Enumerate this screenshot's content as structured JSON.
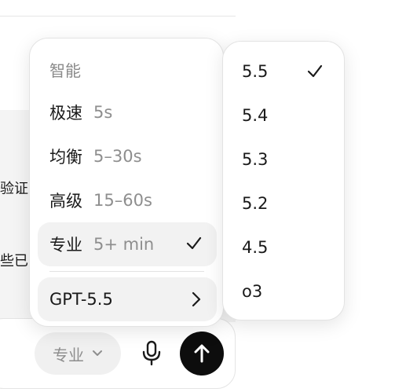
{
  "background": {
    "line1": "验证",
    "line2": "些已"
  },
  "composer": {
    "mode_label": "专业",
    "mode_icon": "chevron-down-icon",
    "mic_icon": "microphone-icon",
    "send_icon": "arrow-up-icon"
  },
  "menu": {
    "heading": "智能",
    "items": [
      {
        "label": "极速",
        "sub": "5s",
        "selected": false
      },
      {
        "label": "均衡",
        "sub": "5–30s",
        "selected": false
      },
      {
        "label": "高级",
        "sub": "15–60s",
        "selected": false
      },
      {
        "label": "专业",
        "sub": "5+ min",
        "selected": true
      }
    ],
    "model_item": {
      "label": "GPT-5.5",
      "icon": "chevron-right-icon"
    }
  },
  "submenu": {
    "items": [
      {
        "label": "5.5",
        "selected": true
      },
      {
        "label": "5.4",
        "selected": false
      },
      {
        "label": "5.3",
        "selected": false
      },
      {
        "label": "5.2",
        "selected": false
      },
      {
        "label": "4.5",
        "selected": false
      },
      {
        "label": "o3",
        "selected": false
      }
    ]
  },
  "colors": {
    "accent": "#0d0d0d",
    "muted_text": "#8e8e8e",
    "hover_bg": "#f2f2f2"
  }
}
